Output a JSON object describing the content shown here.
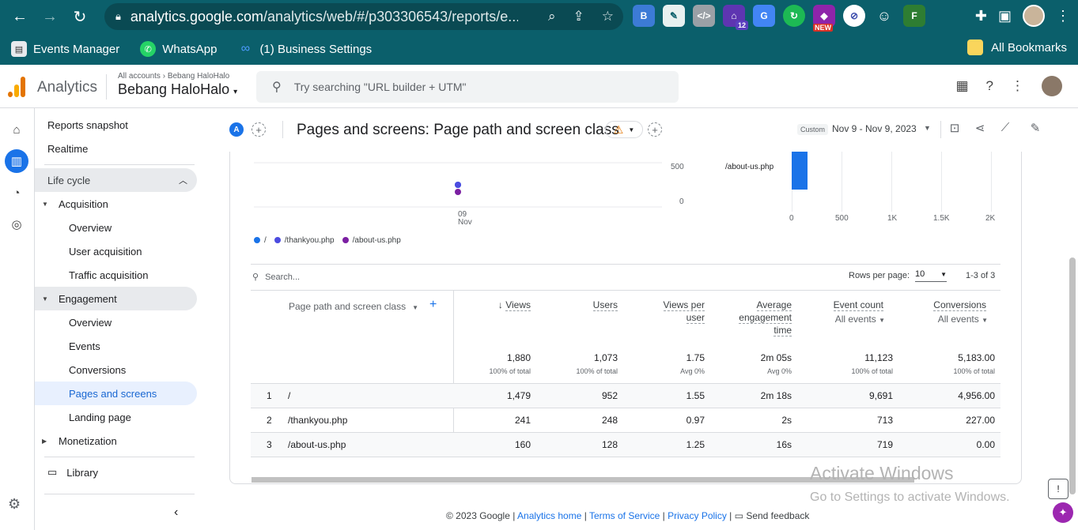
{
  "browser": {
    "url_host": "analytics.google.com",
    "url_path": "/analytics/web/#/p303306543/reports/e...",
    "bookmarks": [
      {
        "label": "Events Manager",
        "icon": "events-manager-icon"
      },
      {
        "label": "WhatsApp",
        "icon": "whatsapp-icon"
      },
      {
        "label": "(1) Business Settings",
        "icon": "meta-icon"
      }
    ],
    "all_bookmarks": "All Bookmarks",
    "ext_badge": "12",
    "ext_new": "NEW"
  },
  "ga": {
    "app_name": "Analytics",
    "breadcrumb_all": "All accounts",
    "breadcrumb_account": "Bebang HaloHalo",
    "property": "Bebang HaloHalo",
    "search_placeholder": "Try searching \"URL builder + UTM\""
  },
  "nav": {
    "reports_snapshot": "Reports snapshot",
    "realtime": "Realtime",
    "life_cycle": "Life cycle",
    "acquisition": "Acquisition",
    "acq_overview": "Overview",
    "user_acquisition": "User acquisition",
    "traffic_acquisition": "Traffic acquisition",
    "engagement": "Engagement",
    "eng_overview": "Overview",
    "events": "Events",
    "conversions": "Conversions",
    "pages_and_screens": "Pages and screens",
    "landing_page": "Landing page",
    "monetization": "Monetization",
    "library": "Library"
  },
  "title": {
    "compare_letter": "A",
    "page_title": "Pages and screens: Page path and screen class",
    "date_label": "Custom",
    "date_range": "Nov 9 - Nov 9, 2023"
  },
  "chart_data": [
    {
      "type": "scatter",
      "y_ticks": [
        "500",
        "0"
      ],
      "x_tick_day": "09",
      "x_tick_month": "Nov",
      "legend": [
        "/",
        "/thankyou.php",
        "/about-us.php"
      ],
      "colors": [
        "#1a73e8",
        "#4c4ce0",
        "#7b1fa2"
      ]
    },
    {
      "type": "bar",
      "categories": [
        "/about-us.php"
      ],
      "values": [
        160
      ],
      "x_ticks": [
        "0",
        "500",
        "1K",
        "1.5K",
        "2K"
      ],
      "xlim": [
        0,
        2000
      ]
    }
  ],
  "table": {
    "search_placeholder": "Search...",
    "rows_per_page_label": "Rows per page:",
    "rows_per_page": "10",
    "range": "1-3 of 3",
    "dimension_header": "Page path and screen class",
    "headers": {
      "views": "Views",
      "users": "Users",
      "vpu1": "Views per",
      "vpu2": "user",
      "aet1": "Average",
      "aet2": "engagement",
      "aet3": "time",
      "event_count": "Event count",
      "event_sub": "All events",
      "conversions": "Conversions",
      "conv_sub": "All events"
    },
    "totals": {
      "views": "1,880",
      "views_sub": "100% of total",
      "users": "1,073",
      "users_sub": "100% of total",
      "vpu": "1.75",
      "vpu_sub": "Avg 0%",
      "aet": "2m 05s",
      "aet_sub": "Avg 0%",
      "events": "11,123",
      "events_sub": "100% of total",
      "conv": "5,183.00",
      "conv_sub": "100% of total"
    },
    "rows": [
      {
        "n": "1",
        "path": "/",
        "views": "1,479",
        "users": "952",
        "vpu": "1.55",
        "aet": "2m 18s",
        "events": "9,691",
        "conv": "4,956.00"
      },
      {
        "n": "2",
        "path": "/thankyou.php",
        "views": "241",
        "users": "248",
        "vpu": "0.97",
        "aet": "2s",
        "events": "713",
        "conv": "227.00"
      },
      {
        "n": "3",
        "path": "/about-us.php",
        "views": "160",
        "users": "128",
        "vpu": "1.25",
        "aet": "16s",
        "events": "719",
        "conv": "0.00"
      }
    ]
  },
  "footer": {
    "copyright": "© 2023 Google |",
    "analytics_home": "Analytics home",
    "terms": "Terms of Service",
    "privacy": "Privacy Policy",
    "send_feedback": "Send feedback"
  },
  "watermark": {
    "line1": "Activate Windows",
    "line2": "Go to Settings to activate Windows."
  }
}
